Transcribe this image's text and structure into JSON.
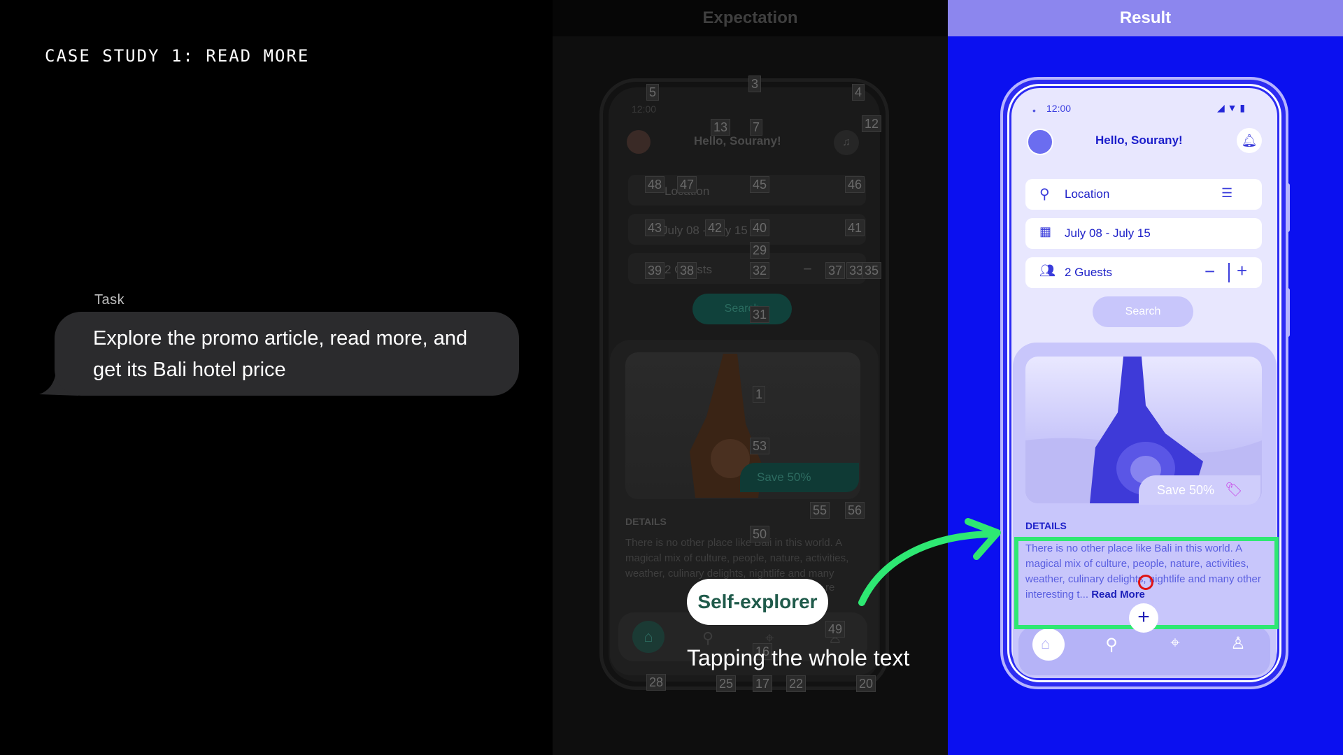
{
  "left": {
    "case_title": "CASE STUDY 1: READ MORE",
    "task_label": "Task",
    "task_text": "Explore the promo article, read more, and get its Bali hotel price"
  },
  "expectation": {
    "header": "Expectation",
    "phone": {
      "time": "12:00",
      "greeting": "Hello, Sourany!",
      "location": "Location",
      "dates": "July 08 - July 15",
      "guests": "2 Guests",
      "search": "Search",
      "save": "Save 50%",
      "details_title": "DETAILS",
      "details_text": "There is no other place like Bali in this world. A magical mix of culture, people, nature, activities, weather, culinary delights, nightlife and many",
      "details_more": "re"
    },
    "tags": [
      "3",
      "5",
      "4",
      "13",
      "7",
      "12",
      "48",
      "47",
      "45",
      "46",
      "43",
      "42",
      "40",
      "41",
      "29",
      "39",
      "38",
      "32",
      "37",
      "33",
      "35",
      "31",
      "1",
      "53",
      "55",
      "56",
      "50",
      "49",
      "16",
      "28",
      "25",
      "17",
      "22",
      "20"
    ]
  },
  "result": {
    "header": "Result",
    "phone": {
      "time": "12:00",
      "greeting": "Hello, Sourany!",
      "location": "Location",
      "dates": "July 08 - July 15",
      "guests": "2 Guests",
      "search": "Search",
      "save": "Save 50%",
      "details_title": "DETAILS",
      "details_text": "There is no other place like Bali in this world. A magical mix of culture, people, nature, activities, weather, culinary delights, nightlife and many other interesting t...",
      "read_more": "Read More"
    }
  },
  "overlay": {
    "agent_label": "Self-explorer",
    "action_caption": "Tapping the whole text"
  },
  "colors": {
    "result_bg": "#0b10f0",
    "result_header": "#8c86ee",
    "highlight": "#2ee873",
    "tap_marker": "#e01313"
  }
}
